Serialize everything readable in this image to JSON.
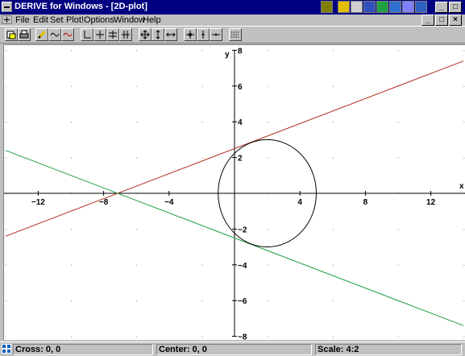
{
  "window": {
    "title": "DERIVE for Windows - [2D-plot]"
  },
  "menu": [
    "File",
    "Edit",
    "Set",
    "Plot!",
    "Options",
    "Window",
    "Help"
  ],
  "toolbar_icons": [
    "print-setup-icon",
    "print-icon",
    "pencil-icon",
    "wave-icon",
    "red-wave-icon",
    "axes-icon",
    "crosshair-icon",
    "center-icon",
    "hash-icon",
    "zoom-in-both-icon",
    "zoom-in-vertical-icon",
    "zoom-in-horizontal-icon",
    "zoom-out-both-icon",
    "zoom-out-vertical-icon",
    "zoom-out-horizontal-icon",
    "grid-icon"
  ],
  "taskbar_icons": [
    "app-icon-1",
    "app-icon-2",
    "app-icon-3",
    "app-icon-4",
    "app-icon-5",
    "app-icon-6",
    "app-icon-7",
    "app-icon-8"
  ],
  "window_buttons": {
    "minimize": "_",
    "maximize": "□",
    "close": "×"
  },
  "status": {
    "cross": "Cross: 0, 0",
    "center": "Center: 0, 0",
    "scale": "Scale: 4:2"
  },
  "colors": {
    "titlebar": "#000080",
    "line1": "#b03020",
    "line2": "#20a040",
    "circle": "#000000"
  },
  "chart_data": {
    "type": "line",
    "xlabel": "x",
    "ylabel": "y",
    "xlim": [
      -14,
      14
    ],
    "ylim": [
      -8,
      8
    ],
    "x_ticks": [
      -12,
      -8,
      -4,
      4,
      8,
      12
    ],
    "y_ticks": [
      -8,
      -6,
      -4,
      -2,
      2,
      4,
      6,
      8
    ],
    "grid": "dots",
    "series": [
      {
        "kind": "line",
        "color": "#b03020",
        "points": [
          [
            -14,
            -2.4
          ],
          [
            14,
            7.4
          ]
        ]
      },
      {
        "kind": "line",
        "color": "#20a040",
        "points": [
          [
            -14,
            2.4
          ],
          [
            14,
            -7.4
          ]
        ]
      },
      {
        "kind": "circle",
        "color": "#000000",
        "center": [
          2,
          0
        ],
        "radius": 3
      }
    ]
  }
}
